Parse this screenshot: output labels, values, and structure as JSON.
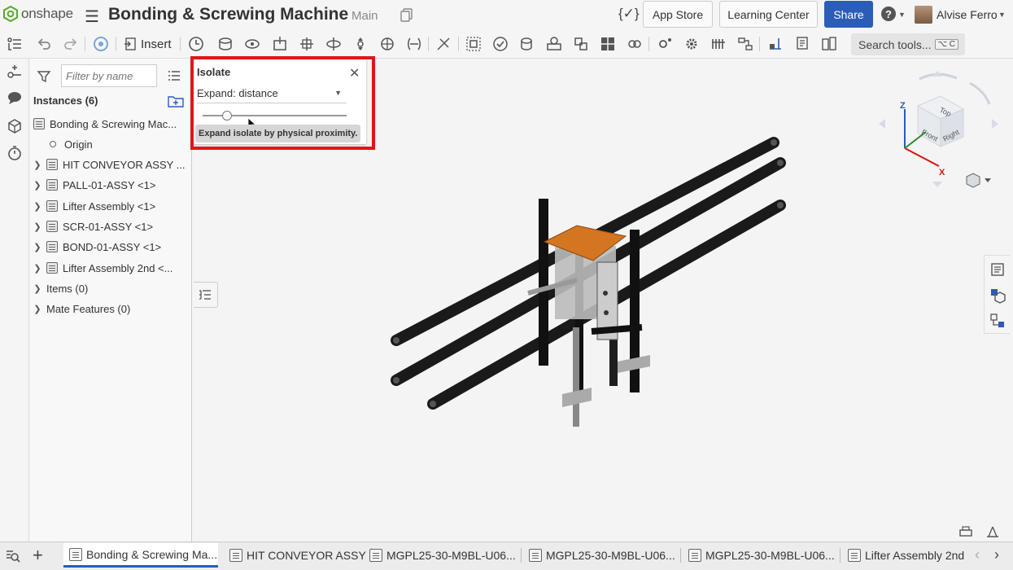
{
  "app": {
    "logo_text": "onshape",
    "title": "Bonding & Screwing Machine",
    "branch": "Main"
  },
  "header": {
    "app_store": "App Store",
    "learning_center": "Learning Center",
    "share": "Share",
    "help": "?",
    "user_name": "Alvise Ferro"
  },
  "toolbar": {
    "insert_label": "Insert",
    "search_placeholder": "Search tools...",
    "search_shortcut": "⌥ C"
  },
  "panel": {
    "filter_placeholder": "Filter by name",
    "instances_header": "Instances (6)",
    "root_item": "Bonding & Screwing Mac...",
    "origin": "Origin",
    "items": [
      {
        "label": "HIT CONVEYOR ASSY ..."
      },
      {
        "label": "PALL-01-ASSY <1>"
      },
      {
        "label": "Lifter Assembly <1>"
      },
      {
        "label": "SCR-01-ASSY <1>"
      },
      {
        "label": "BOND-01-ASSY <1>"
      },
      {
        "label": "Lifter Assembly 2nd <..."
      }
    ],
    "items_folder": "Items (0)",
    "mate_features": "Mate Features (0)"
  },
  "isolate": {
    "title": "Isolate",
    "mode": "Expand: distance",
    "slider_value": 0.17,
    "tooltip": "Expand isolate by physical proximity."
  },
  "viewcube": {
    "top": "Top",
    "front": "Front",
    "right": "Right",
    "axis_x": "X",
    "axis_z": "Z"
  },
  "tabs": [
    {
      "label": "Bonding & Screwing Ma..."
    },
    {
      "label": "HIT CONVEYOR ASSY"
    },
    {
      "label": "MGPL25-30-M9BL-U06..."
    },
    {
      "label": "MGPL25-30-M9BL-U06..."
    },
    {
      "label": "MGPL25-30-M9BL-U06..."
    },
    {
      "label": "Lifter Assembly 2nd"
    }
  ],
  "colors": {
    "accent": "#2b5db8",
    "highlight": "#e0151b",
    "plate": "#d4751f"
  }
}
